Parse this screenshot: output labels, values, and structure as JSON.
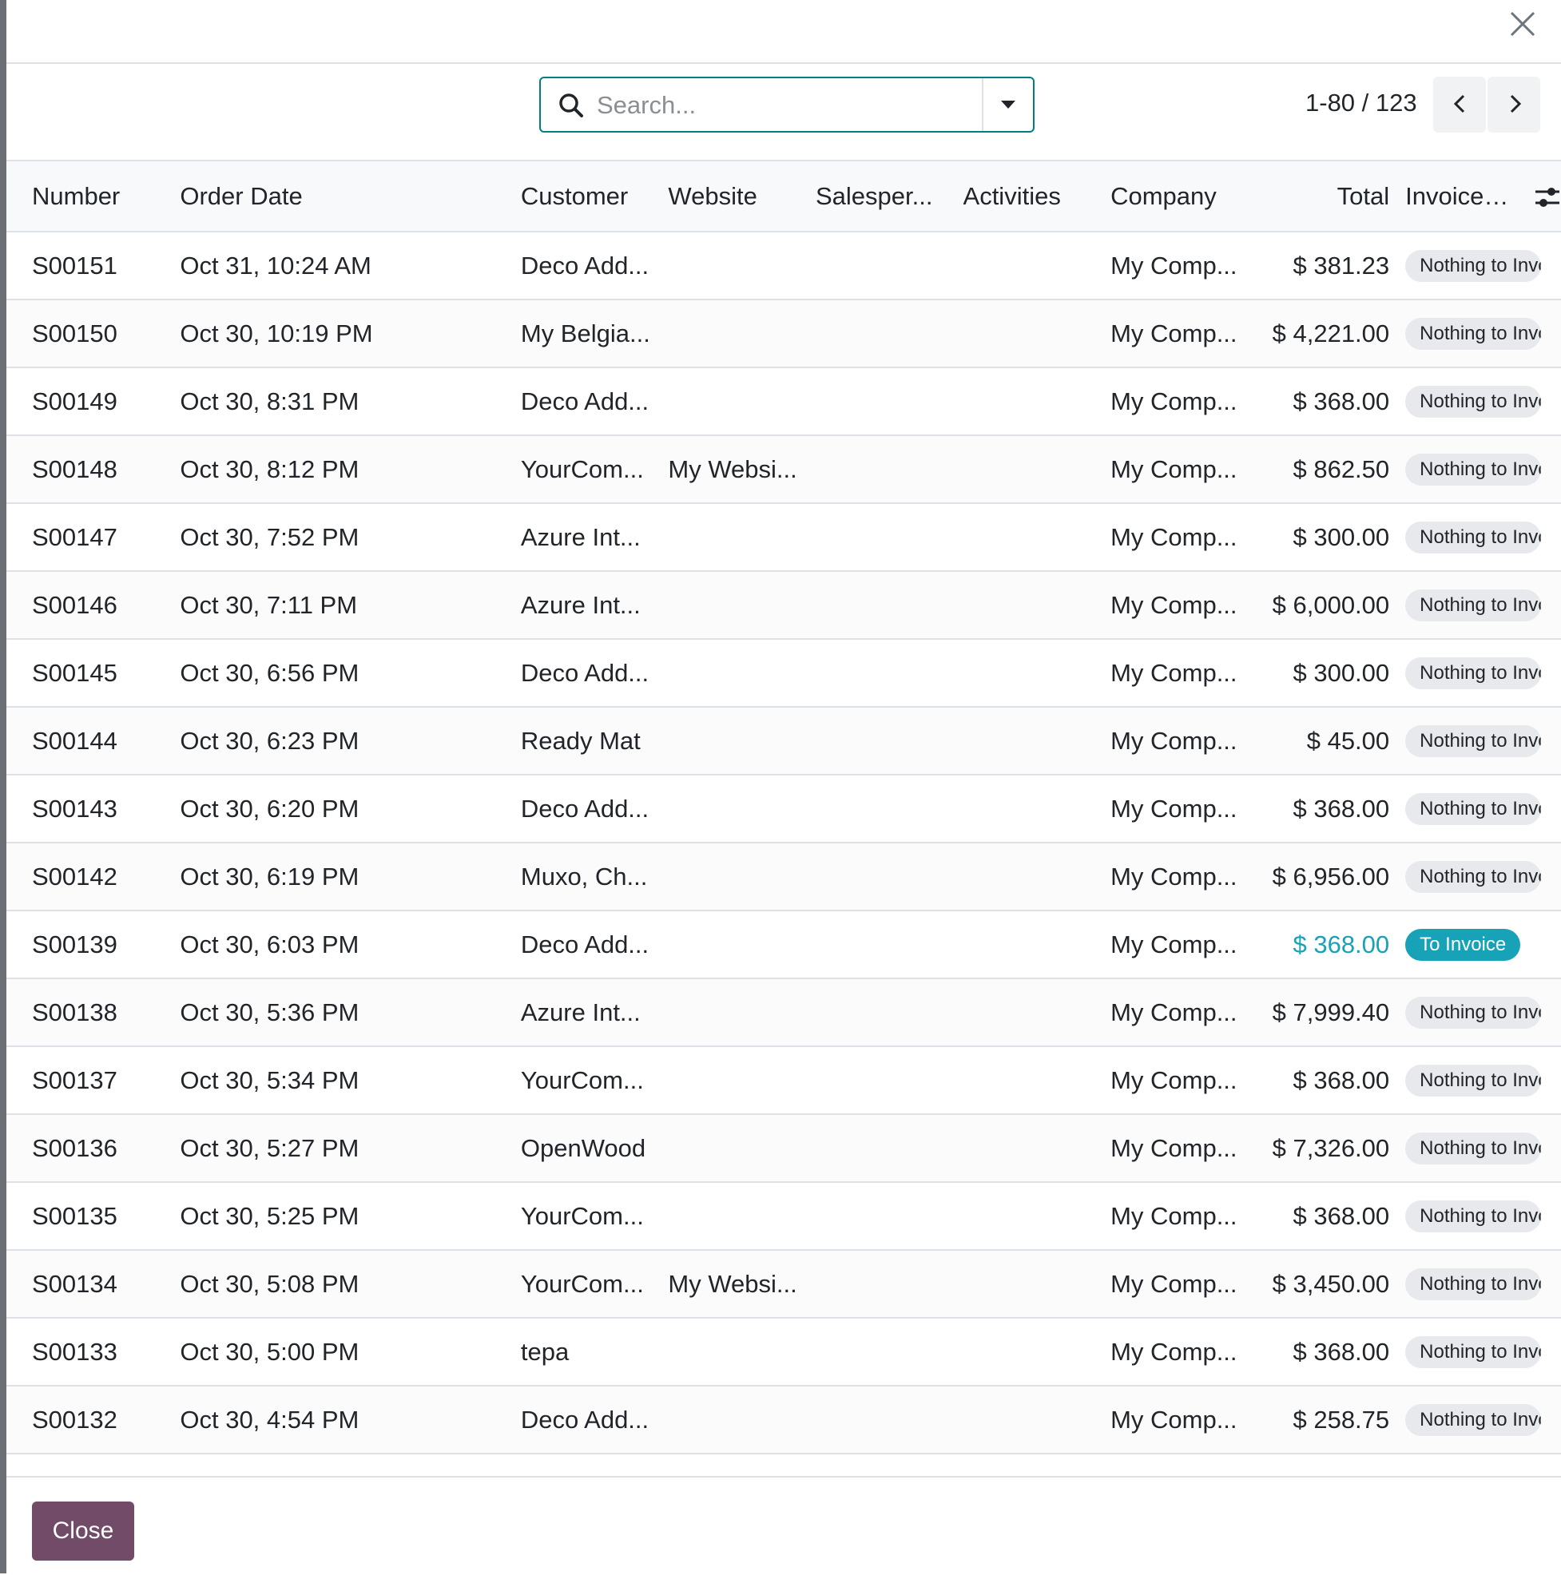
{
  "header": {
    "close_icon": "close-icon"
  },
  "search": {
    "placeholder": "Search..."
  },
  "pager": {
    "value": "1-80 / 123"
  },
  "table": {
    "columns": [
      "Number",
      "Order Date",
      "Customer",
      "Website",
      "Salesper...",
      "Activities",
      "Company",
      "Total",
      "Invoice Status"
    ],
    "rows": [
      {
        "number": "S00151",
        "date": "Oct 31, 10:24 AM",
        "customer": "Deco Add...",
        "website": "",
        "company": "My Comp...",
        "total": "$ 381.23",
        "status": "Nothing to Invoice"
      },
      {
        "number": "S00150",
        "date": "Oct 30, 10:19 PM",
        "customer": "My Belgia...",
        "website": "",
        "company": "My Comp...",
        "total": "$ 4,221.00",
        "status": "Nothing to Invoice"
      },
      {
        "number": "S00149",
        "date": "Oct 30, 8:31 PM",
        "customer": "Deco Add...",
        "website": "",
        "company": "My Comp...",
        "total": "$ 368.00",
        "status": "Nothing to Invoice"
      },
      {
        "number": "S00148",
        "date": "Oct 30, 8:12 PM",
        "customer": "YourCom...",
        "website": "My Websi...",
        "company": "My Comp...",
        "total": "$ 862.50",
        "status": "Nothing to Invoice"
      },
      {
        "number": "S00147",
        "date": "Oct 30, 7:52 PM",
        "customer": "Azure Int...",
        "website": "",
        "company": "My Comp...",
        "total": "$ 300.00",
        "status": "Nothing to Invoice"
      },
      {
        "number": "S00146",
        "date": "Oct 30, 7:11 PM",
        "customer": "Azure Int...",
        "website": "",
        "company": "My Comp...",
        "total": "$ 6,000.00",
        "status": "Nothing to Invoice"
      },
      {
        "number": "S00145",
        "date": "Oct 30, 6:56 PM",
        "customer": "Deco Add...",
        "website": "",
        "company": "My Comp...",
        "total": "$ 300.00",
        "status": "Nothing to Invoice"
      },
      {
        "number": "S00144",
        "date": "Oct 30, 6:23 PM",
        "customer": "Ready Mat",
        "website": "",
        "company": "My Comp...",
        "total": "$ 45.00",
        "status": "Nothing to Invoice"
      },
      {
        "number": "S00143",
        "date": "Oct 30, 6:20 PM",
        "customer": "Deco Add...",
        "website": "",
        "company": "My Comp...",
        "total": "$ 368.00",
        "status": "Nothing to Invoice"
      },
      {
        "number": "S00142",
        "date": "Oct 30, 6:19 PM",
        "customer": "Muxo, Ch...",
        "website": "",
        "company": "My Comp...",
        "total": "$ 6,956.00",
        "status": "Nothing to Invoice"
      },
      {
        "number": "S00139",
        "date": "Oct 30, 6:03 PM",
        "customer": "Deco Add...",
        "website": "",
        "company": "My Comp...",
        "total": "$ 368.00",
        "status": "To Invoice"
      },
      {
        "number": "S00138",
        "date": "Oct 30, 5:36 PM",
        "customer": "Azure Int...",
        "website": "",
        "company": "My Comp...",
        "total": "$ 7,999.40",
        "status": "Nothing to Invoice"
      },
      {
        "number": "S00137",
        "date": "Oct 30, 5:34 PM",
        "customer": "YourCom...",
        "website": "",
        "company": "My Comp...",
        "total": "$ 368.00",
        "status": "Nothing to Invoice"
      },
      {
        "number": "S00136",
        "date": "Oct 30, 5:27 PM",
        "customer": "OpenWood",
        "website": "",
        "company": "My Comp...",
        "total": "$ 7,326.00",
        "status": "Nothing to Invoice"
      },
      {
        "number": "S00135",
        "date": "Oct 30, 5:25 PM",
        "customer": "YourCom...",
        "website": "",
        "company": "My Comp...",
        "total": "$ 368.00",
        "status": "Nothing to Invoice"
      },
      {
        "number": "S00134",
        "date": "Oct 30, 5:08 PM",
        "customer": "YourCom...",
        "website": "My Websi...",
        "company": "My Comp...",
        "total": "$ 3,450.00",
        "status": "Nothing to Invoice"
      },
      {
        "number": "S00133",
        "date": "Oct 30, 5:00 PM",
        "customer": "tepa",
        "website": "",
        "company": "My Comp...",
        "total": "$ 368.00",
        "status": "Nothing to Invoice"
      },
      {
        "number": "S00132",
        "date": "Oct 30, 4:54 PM",
        "customer": "Deco Add...",
        "website": "",
        "company": "My Comp...",
        "total": "$ 258.75",
        "status": "Nothing to Invoice"
      }
    ]
  },
  "footer": {
    "close_label": "Close"
  },
  "colors": {
    "accent": "#017e84",
    "primary": "#714b67",
    "info": "#17a2b8"
  }
}
